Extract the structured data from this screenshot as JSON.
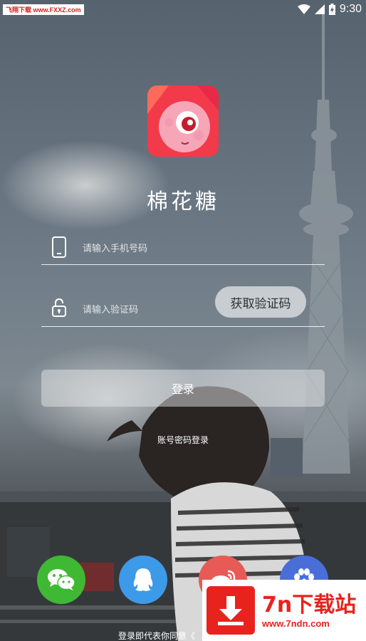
{
  "status_bar": {
    "time": "9:30",
    "watermark": "飞翔下载 www.FXXZ.com"
  },
  "app": {
    "name": "棉花糖"
  },
  "form": {
    "phone_placeholder": "请输入手机号码",
    "code_placeholder": "请输入验证码",
    "get_code_label": "获取验证码",
    "login_label": "登录",
    "password_login_label": "账号密码登录"
  },
  "social_logins": [
    {
      "name": "wechat",
      "icon": "wechat-icon",
      "color": "#3fb834"
    },
    {
      "name": "qq",
      "icon": "qq-icon",
      "color": "#3d9ae8"
    },
    {
      "name": "weibo",
      "icon": "weibo-icon",
      "color": "#e85a55"
    },
    {
      "name": "baidu",
      "icon": "baidu-icon",
      "color": "#4a6ed8"
    }
  ],
  "footer": {
    "agreement_text": "登录即代表你同意《"
  },
  "ad_banner": {
    "title": "7n下载站",
    "url": "www.7ndn.com"
  }
}
